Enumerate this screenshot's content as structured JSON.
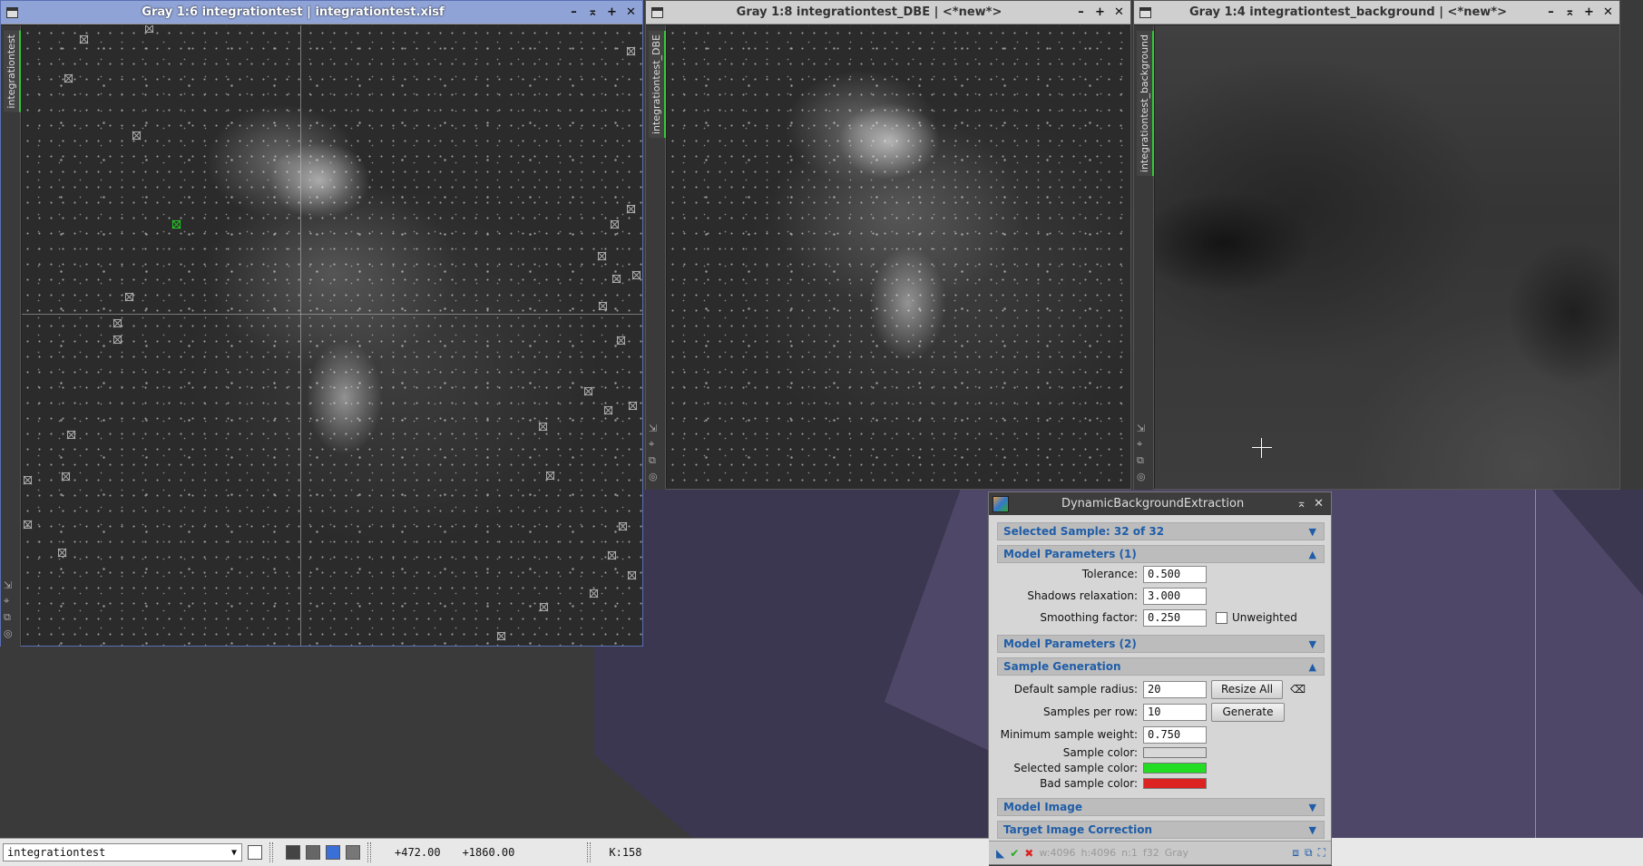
{
  "windows": {
    "main": {
      "title": "Gray 1:6 integrationtest | integrationtest.xisf",
      "tab": "integrationtest"
    },
    "dbe": {
      "title": "Gray 1:8 integrationtest_DBE | <*new*>",
      "tab": "integrationtest_DBE"
    },
    "background": {
      "title": "Gray 1:4 integrationtest_background | <*new*>",
      "tab": "integrationtest_background"
    }
  },
  "dialog": {
    "title": "DynamicBackgroundExtraction",
    "sections": {
      "selected_sample": "Selected Sample: 32 of 32",
      "model_params_1": "Model Parameters (1)",
      "model_params_2": "Model Parameters (2)",
      "sample_generation": "Sample Generation",
      "model_image": "Model Image",
      "target_correction": "Target Image Correction"
    },
    "tolerance": {
      "label": "Tolerance:",
      "value": "0.500"
    },
    "shadows": {
      "label": "Shadows relaxation:",
      "value": "3.000"
    },
    "smoothing": {
      "label": "Smoothing factor:",
      "value": "0.250"
    },
    "unweighted": "Unweighted",
    "sample_radius": {
      "label": "Default sample radius:",
      "value": "20"
    },
    "resize_all": "Resize All",
    "samples_per_row": {
      "label": "Samples per row:",
      "value": "10"
    },
    "generate": "Generate",
    "min_weight": {
      "label": "Minimum sample weight:",
      "value": "0.750"
    },
    "sample_color": {
      "label": "Sample color:",
      "color": "#d8d8d8"
    },
    "selected_color": {
      "label": "Selected sample color:",
      "color": "#22dd22"
    },
    "bad_color": {
      "label": "Bad sample color:",
      "color": "#dd2222"
    },
    "bottom": {
      "w": "w:4096",
      "h": "h:4096",
      "n": "n:1",
      "f": "f32",
      "mode": "Gray"
    }
  },
  "statusbar": {
    "view": "integrationtest",
    "x": "+472.00",
    "y": "+1860.00",
    "k": "K:158"
  },
  "toolbar_icons": [
    "close-icon",
    "maximize-icon",
    "shade-icon",
    "restore-icon"
  ]
}
